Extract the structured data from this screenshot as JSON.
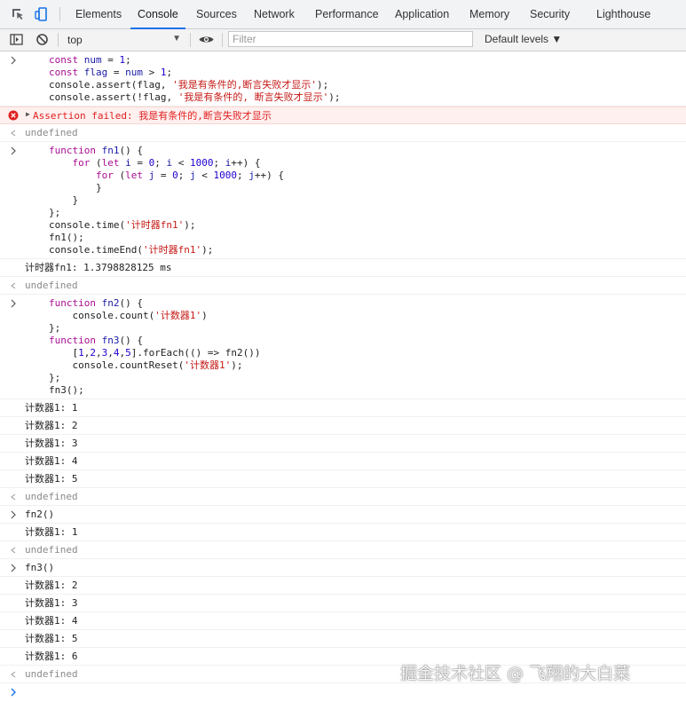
{
  "tabs": [
    {
      "label": "Elements"
    },
    {
      "label": "Console"
    },
    {
      "label": "Sources"
    },
    {
      "label": "Network"
    },
    {
      "label": "Performance"
    },
    {
      "label": "Application"
    },
    {
      "label": "Memory"
    },
    {
      "label": "Security"
    },
    {
      "label": "Lighthouse"
    }
  ],
  "active_tab": "Console",
  "toolbar": {
    "context": "top",
    "filter_placeholder": "Filter",
    "levels": "Default levels ▼"
  },
  "console": {
    "block1": [
      "const num = 1;",
      "const flag = num > 1;",
      "console.assert(flag, '我是有条件的,断言失败才显示');",
      "console.assert(!flag, '我是有条件的, 断言失败才显示');"
    ],
    "assertion": "Assertion failed: 我是有条件的,断言失败才显示",
    "undefined": "undefined",
    "block2": [
      "function fn1() {",
      "    for (let i = 0; i < 1000; i++) {",
      "        for (let j = 0; j < 1000; j++) {",
      "        }",
      "    }",
      "};",
      "console.time('计时器fn1');",
      "fn1();",
      "console.timeEnd('计时器fn1');"
    ],
    "timer_output": "计时器fn1: 1.3798828125 ms",
    "block3": [
      "function fn2() {",
      "    console.count('计数器1')",
      "};",
      "function fn3() {",
      "    [1,2,3,4,5].forEach(() => fn2())",
      "    console.countReset('计数器1');",
      "};",
      "fn3();"
    ],
    "counts_a": [
      "计数器1: 1",
      "计数器1: 2",
      "计数器1: 3",
      "计数器1: 4",
      "计数器1: 5"
    ],
    "cmd_fn2": "fn2()",
    "count_b": "计数器1: 1",
    "cmd_fn3": "fn3()",
    "counts_c": [
      "计数器1: 2",
      "计数器1: 3",
      "计数器1: 4",
      "计数器1: 5",
      "计数器1: 6"
    ]
  },
  "watermark": "掘金技术社区 @ 飞翔的大白菜",
  "colors": {
    "accent": "#1a73e8",
    "error_text": "#e02020",
    "error_bg": "#fef0ef",
    "keyword": "#aa0d91",
    "string": "#c41a16",
    "number": "#1c00cf"
  }
}
